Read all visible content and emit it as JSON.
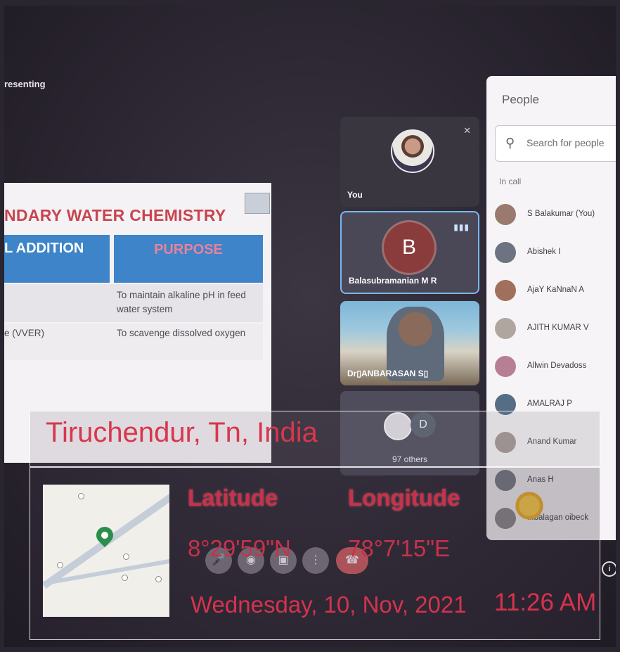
{
  "presenting_label": "resenting",
  "slide": {
    "title": "NDARY WATER CHEMISTRY",
    "col1_header": "L ADDITION",
    "col2_header": "PURPOSE",
    "rows": [
      {
        "col1": "",
        "col2": "To maintain alkaline pH in feed water system"
      },
      {
        "col1": "e (VVER)",
        "col2": "To scavenge dissolved oxygen"
      }
    ]
  },
  "tiles": {
    "you_label": "You",
    "speaker_initial": "B",
    "speaker_name": "Balasubramanian M R",
    "video_name": "Dr▯ANBARASAN S▯",
    "others_initial": "D",
    "others_label": "97 others"
  },
  "people_panel": {
    "title": "People",
    "search_placeholder": "Search for people",
    "section_label": "In call",
    "participants": [
      {
        "name": "S Balakumar (You)",
        "avatar_color": "#9a7a6e"
      },
      {
        "name": "Abishek I",
        "avatar_color": "#6d7380"
      },
      {
        "name": "AjaY KaNnaN A",
        "avatar_color": "#a1705c"
      },
      {
        "name": "AJITH KUMAR V",
        "avatar_color": "#b0a6a0"
      },
      {
        "name": "Allwin Devadoss",
        "avatar_color": "#b77f93"
      },
      {
        "name": "AMALRAJ P",
        "avatar_color": "#566e85"
      },
      {
        "name": "Anand Kumar",
        "avatar_color": "#a59a96"
      },
      {
        "name": "Anas H",
        "avatar_color": "#7a7f88"
      },
      {
        "name": "...balagan oibeck",
        "avatar_color": "#8d8a8a"
      }
    ]
  },
  "controls": {
    "mic_icon": "mic-icon",
    "camera_icon": "camera-icon",
    "present_icon": "present-icon",
    "more_icon": "more-icon",
    "end_call_icon": "end-call-icon"
  },
  "gps": {
    "location": "Tiruchendur, Tn, India",
    "latitude_label": "Latitude",
    "longitude_label": "Longitude",
    "latitude_value": "8°29'59\"N",
    "longitude_value": "78°7'15\"E",
    "date": "Wednesday, 10, Nov, 2021",
    "time": "11:26 AM"
  },
  "colors": {
    "overlay_text": "#d5334e",
    "slide_header": "#3d84c8",
    "active_speaker_border": "#78b7f4",
    "end_call": "#d85f62"
  }
}
